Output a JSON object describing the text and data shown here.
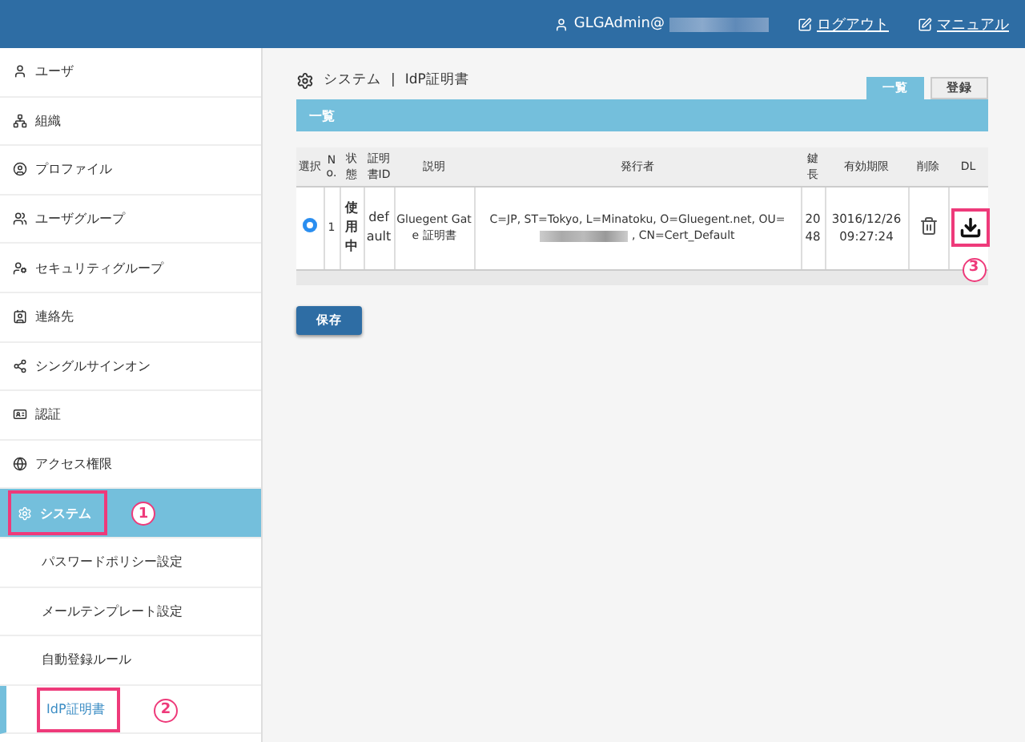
{
  "header": {
    "user": "GLGAdmin@",
    "links": [
      {
        "label": "ログアウト"
      },
      {
        "label": "マニュアル"
      }
    ]
  },
  "sidebar": {
    "items": [
      {
        "label": "ユーザ",
        "kind": "main",
        "selected": false
      },
      {
        "label": "組織",
        "kind": "main",
        "selected": false
      },
      {
        "label": "プロファイル",
        "kind": "main",
        "selected": false
      },
      {
        "label": "ユーザグループ",
        "kind": "main",
        "selected": false
      },
      {
        "label": "セキュリティグループ",
        "kind": "main",
        "selected": false
      },
      {
        "label": "連絡先",
        "kind": "main",
        "selected": false
      },
      {
        "label": "シングルサインオン",
        "kind": "main",
        "selected": false
      },
      {
        "label": "認証",
        "kind": "main",
        "selected": false
      },
      {
        "label": "アクセス権限",
        "kind": "main",
        "selected": false
      },
      {
        "label": "システム",
        "kind": "main",
        "selected": true,
        "callout": "1"
      },
      {
        "label": "パスワードポリシー設定",
        "kind": "sub",
        "selected": false
      },
      {
        "label": "メールテンプレート設定",
        "kind": "sub",
        "selected": false
      },
      {
        "label": "自動登録ルール",
        "kind": "sub",
        "selected": false
      },
      {
        "label": "IdP証明書",
        "kind": "sub",
        "selected": true,
        "callout": "2"
      }
    ]
  },
  "breadcrumb": {
    "section": "システム",
    "separator": "|",
    "page": "IdP証明書"
  },
  "tabs": [
    {
      "label": "一覧",
      "selected": true
    },
    {
      "label": "登録",
      "selected": false
    }
  ],
  "panel_title": "一覧",
  "table": {
    "columns": [
      "選択",
      "No.",
      "状態",
      "証明書ID",
      "説明",
      "発行者",
      "鍵長",
      "有効期限",
      "削除",
      "DL"
    ],
    "rows": [
      {
        "selected": true,
        "no": "1",
        "status": "使用中",
        "id": "default",
        "description": "Gluegent Gate 証明書",
        "issuer_before": "C=JP, ST=Tokyo, L=Minatoku, O=Gluegent.net, OU=",
        "issuer_after": ", CN=Cert_Default",
        "key_length": "2048",
        "expires": "3016/12/26 09:27:24",
        "download_callout": "3"
      }
    ]
  },
  "save_button": "保存"
}
